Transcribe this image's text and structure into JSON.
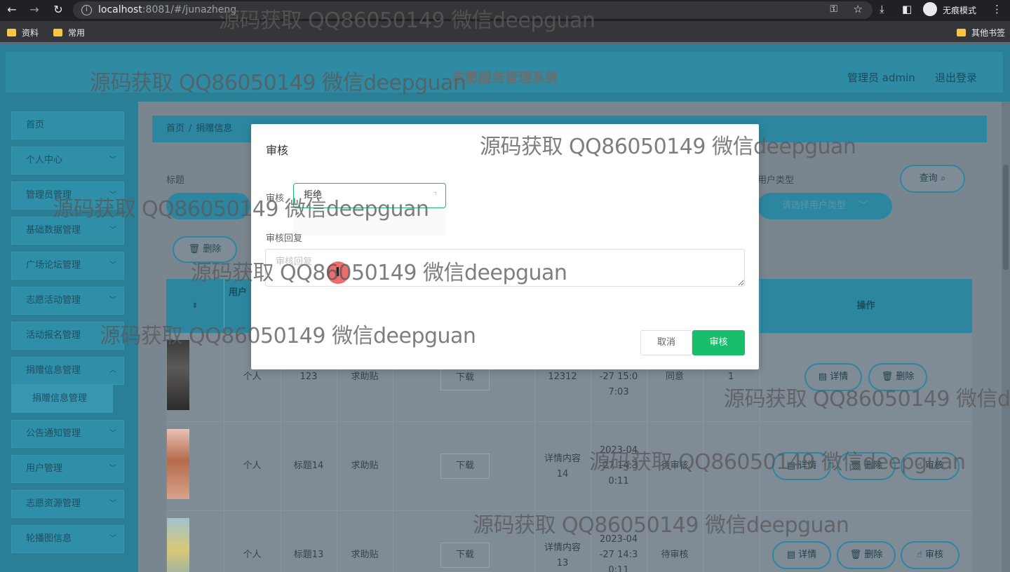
{
  "browser": {
    "url_host": "localhost",
    "url_path": ":8081/#/junazheng",
    "incognito_label": "无痕模式",
    "bookmarks": [
      "资料",
      "常用"
    ],
    "other_bookmarks": "其他书签"
  },
  "header": {
    "title": "志愿服务管理系统",
    "admin": "管理员 admin",
    "logout": "退出登录"
  },
  "sidebar": {
    "items": [
      {
        "label": "首页",
        "chevron": false
      },
      {
        "label": "个人中心",
        "chevron": true
      },
      {
        "label": "管理员管理",
        "chevron": true
      },
      {
        "label": "基础数据管理",
        "chevron": true
      },
      {
        "label": "广场论坛管理",
        "chevron": true
      },
      {
        "label": "志愿活动管理",
        "chevron": true
      },
      {
        "label": "活动报名管理",
        "chevron": true
      },
      {
        "label": "捐赠信息管理",
        "chevron": true
      },
      {
        "label": "公告通知管理",
        "chevron": true
      },
      {
        "label": "用户管理",
        "chevron": true
      },
      {
        "label": "志愿资源管理",
        "chevron": true
      },
      {
        "label": "轮播图信息",
        "chevron": true
      }
    ],
    "active_sub": "捐赠信息管理"
  },
  "breadcrumb": [
    "首页",
    "捐赠信息"
  ],
  "filters": {
    "title_label": "标题",
    "user_type_label": "用户类型",
    "user_type_placeholder": "请选择用户类型",
    "query_button": "查询",
    "delete_button": "删除"
  },
  "table": {
    "headers": {
      "user": "用户",
      "ops": "操作"
    },
    "rows": [
      {
        "type": "个人",
        "title": "123",
        "category": "求助贴",
        "download": "下载",
        "detail": "12312",
        "time": "-27 15:0\n7:03",
        "status": "同意",
        "count": "1",
        "ops": [
          "详情",
          "删除"
        ]
      },
      {
        "type": "个人",
        "title": "标题14",
        "category": "求助贴",
        "download": "下载",
        "detail": "详情内容\n14",
        "time": "2023-04\n-27 14:3\n0:11",
        "status": "待审核",
        "ops": [
          "详情",
          "删除",
          "审核"
        ]
      },
      {
        "type": "个人",
        "title": "标题13",
        "category": "求助贴",
        "download": "下载",
        "detail": "详情内容\n13",
        "time": "2023-04\n-27 14:3\n0:11",
        "status": "待审核",
        "ops": [
          "详情",
          "删除",
          "审核"
        ]
      }
    ]
  },
  "modal": {
    "title": "审核",
    "audit_label": "审核",
    "audit_value": "拒绝",
    "reply_label": "审核回复",
    "reply_placeholder": "审核回复",
    "cancel": "取消",
    "confirm": "审核"
  },
  "watermark": "源码获取 QQ86050149 微信deepguan",
  "watermark_cut": "源码获取 QQ86050149 微信d"
}
